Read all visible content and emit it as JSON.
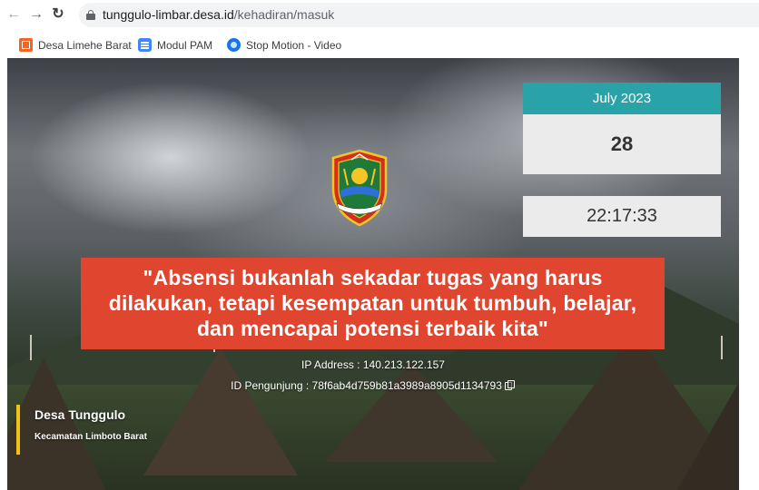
{
  "browser": {
    "url_host": "tunggulo-limbar.desa.id",
    "url_path": "/kehadiran/masuk",
    "bookmarks": [
      {
        "label": "Desa Limehe Barat",
        "icon": "tilde-square-icon"
      },
      {
        "label": "Modul PAM",
        "icon": "google-docs-icon"
      },
      {
        "label": "Stop Motion - Video",
        "icon": "blue-circle-icon"
      }
    ]
  },
  "calendar": {
    "month": "July 2023",
    "day": "28",
    "time": "22:17:33",
    "accent": "#29a3a8"
  },
  "quote": {
    "line1": "\"Absensi bukanlah sekadar tugas yang harus",
    "line2": "dilakukan, tetapi kesempatan untuk tumbuh, belajar,",
    "line3": "dan mencapai potensi terbaik kita\"",
    "color": "#e0452f"
  },
  "visitor": {
    "ip_label": "IP Address : ",
    "ip_value": "140.213.122.157",
    "id_label": "ID Pengunjung : ",
    "id_value": "78f6ab4d759b81a3989a8905d1134793"
  },
  "village": {
    "name": "Desa Tunggulo",
    "district": "Kecamatan Limboto Barat",
    "accent": "#f2c21b"
  }
}
